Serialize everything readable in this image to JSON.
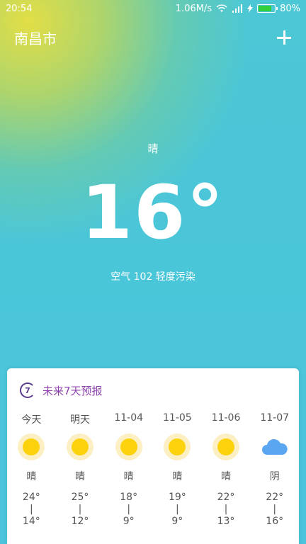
{
  "status": {
    "time": "20:54",
    "network_speed": "1.06M/s",
    "battery_percent": "80%",
    "battery_level": 0.8
  },
  "header": {
    "city": "南昌市"
  },
  "current": {
    "condition": "晴",
    "temperature": "16°",
    "air_quality": "空气 102 轻度污染"
  },
  "forecast": {
    "icon_text": "7",
    "title": "未来7天预报",
    "days": [
      {
        "label": "今天",
        "icon": "sun-icon",
        "condition": "晴",
        "high": "24°",
        "low": "14°"
      },
      {
        "label": "明天",
        "icon": "sun-icon",
        "condition": "晴",
        "high": "25°",
        "low": "12°"
      },
      {
        "label": "11-04",
        "icon": "sun-icon",
        "condition": "晴",
        "high": "18°",
        "low": "9°"
      },
      {
        "label": "11-05",
        "icon": "sun-icon",
        "condition": "晴",
        "high": "19°",
        "low": "9°"
      },
      {
        "label": "11-06",
        "icon": "sun-icon",
        "condition": "晴",
        "high": "22°",
        "low": "13°"
      },
      {
        "label": "11-07",
        "icon": "cloud-icon",
        "condition": "阴",
        "high": "22°",
        "low": "16°"
      }
    ],
    "separator": "|"
  },
  "colors": {
    "accent_purple": "#8e44ad",
    "sun": "#fcd20c",
    "cloud": "#5ba6f0",
    "battery": "#32d13c"
  }
}
